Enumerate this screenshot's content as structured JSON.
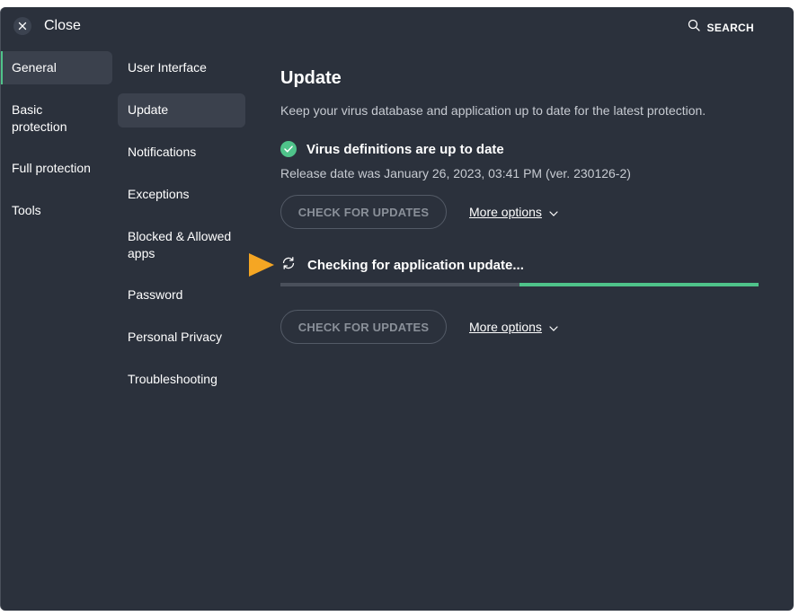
{
  "header": {
    "close_label": "Close",
    "search_label": "SEARCH"
  },
  "nav_primary": {
    "items": [
      {
        "label": "General",
        "active": true
      },
      {
        "label": "Basic protection",
        "active": false
      },
      {
        "label": "Full protection",
        "active": false
      },
      {
        "label": "Tools",
        "active": false
      }
    ]
  },
  "nav_secondary": {
    "items": [
      {
        "label": "User Interface",
        "active": false
      },
      {
        "label": "Update",
        "active": true
      },
      {
        "label": "Notifications",
        "active": false
      },
      {
        "label": "Exceptions",
        "active": false
      },
      {
        "label": "Blocked & Allowed apps",
        "active": false
      },
      {
        "label": "Password",
        "active": false
      },
      {
        "label": "Personal Privacy",
        "active": false
      },
      {
        "label": "Troubleshooting",
        "active": false
      }
    ]
  },
  "content": {
    "title": "Update",
    "description": "Keep your virus database and application up to date for the latest protection.",
    "virus_status": "Virus definitions are up to date",
    "release_info": "Release date was January 26, 2023, 03:41 PM (ver. 230126-2)",
    "check_button_label": "CHECK FOR UPDATES",
    "more_options_label": "More options",
    "app_status": "Checking for application update...",
    "app_progress_percent": 50
  },
  "colors": {
    "background": "#2b313c",
    "accent_green": "#4fc38a",
    "arrow_orange": "#f5a623",
    "active_item_bg": "#3b414d"
  },
  "icons": {
    "close": "close-icon",
    "search": "search-icon",
    "check": "check-circle-icon",
    "chevron": "chevron-down-icon",
    "refresh": "refresh-icon",
    "arrow": "orange-arrow-marker"
  }
}
